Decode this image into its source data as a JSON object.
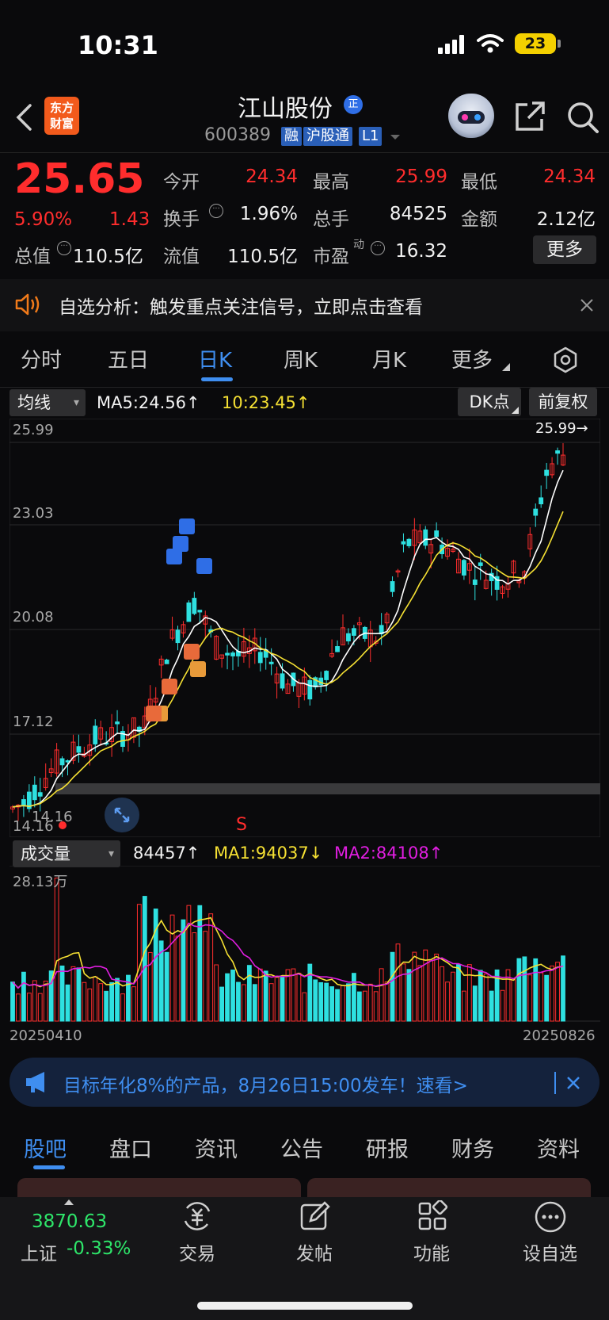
{
  "status_bar": {
    "time": "10:31",
    "battery": "23"
  },
  "header": {
    "logo_line1": "东方",
    "logo_line2": "财富",
    "stock_name": "江山股份",
    "badge": "正",
    "stock_code": "600389",
    "tags": [
      "融",
      "沪股通",
      "L1"
    ]
  },
  "quote": {
    "price": "25.65",
    "change_pct": "5.90%",
    "change_amt": "1.43",
    "open_label": "今开",
    "open": "24.34",
    "high_label": "最高",
    "high": "25.99",
    "low_label": "最低",
    "low": "24.34",
    "turnover_label": "换手",
    "turnover": "1.96%",
    "volume_label": "总手",
    "volume": "84525",
    "amount_label": "金额",
    "amount": "2.12亿",
    "mktcap_label": "总值",
    "mktcap": "110.5亿",
    "float_label": "流值",
    "float_cap": "110.5亿",
    "pe_label": "市盈",
    "pe_sup": "动",
    "pe": "16.32",
    "more": "更多"
  },
  "notice": {
    "text": "自选分析：触发重点关注信号，立即点击查看"
  },
  "period_tabs": [
    "分时",
    "五日",
    "日K",
    "周K",
    "月K",
    "更多"
  ],
  "active_period": "日K",
  "kline": {
    "ma_selector": "均线",
    "ma5": "MA5:24.56↑",
    "ma10": "10:23.45↑",
    "dk_button": "DK点",
    "adjust_button": "前复权",
    "price_labels": [
      "25.99",
      "23.03",
      "20.08",
      "17.12",
      "14.16"
    ],
    "max_marker": "25.99→",
    "min_marker": "14.16",
    "s_marker": "S"
  },
  "volume": {
    "selector": "成交量",
    "value": "84457↑",
    "ma1": "MA1:94037↓",
    "ma2": "MA2:84108↑",
    "scale": "28.13万",
    "start_date": "20250410",
    "end_date": "20250826"
  },
  "colors": {
    "up": "#ff2d2d",
    "down": "#2ee0e0",
    "ma5": "#ffffff",
    "ma10": "#f5e033",
    "ma2": "#e01ee0",
    "accent": "#3f8ef0"
  },
  "promo": {
    "text": "目标年化8%的产品，8月26日15:00发车！速看>"
  },
  "section_tabs": [
    "股吧",
    "盘口",
    "资讯",
    "公告",
    "研报",
    "财务",
    "资料"
  ],
  "bottom_nav": {
    "index_value": "3870.63",
    "index_name": "上证",
    "index_change": "-0.33%",
    "items": [
      "交易",
      "发帖",
      "功能",
      "设自选"
    ]
  }
}
